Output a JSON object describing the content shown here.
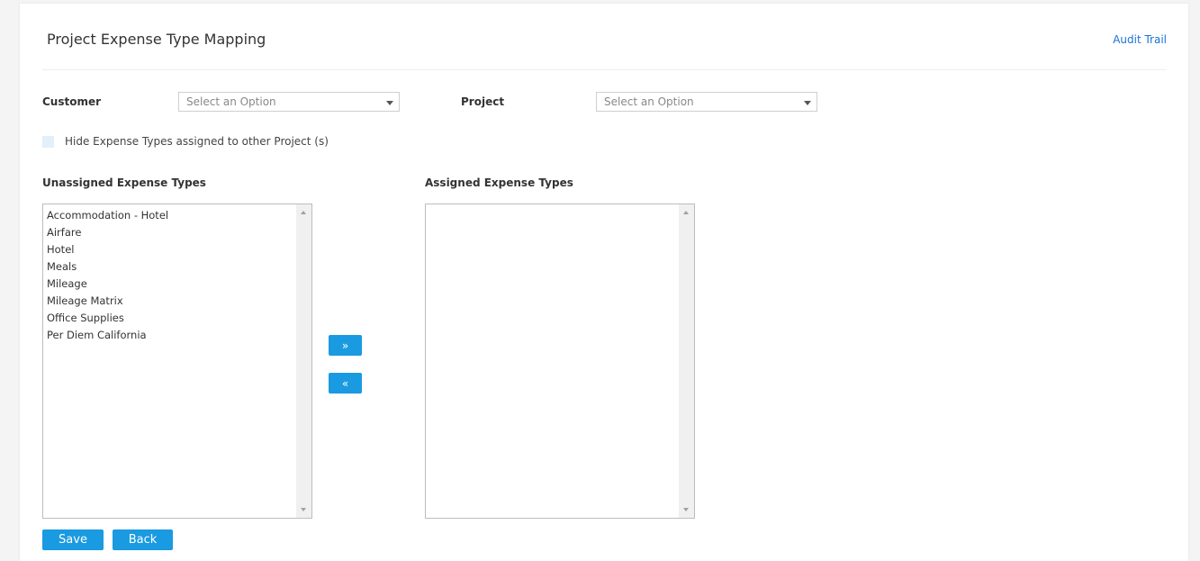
{
  "header": {
    "title": "Project Expense Type Mapping",
    "audit_trail": "Audit Trail"
  },
  "filters": {
    "customer_label": "Customer",
    "customer_placeholder": "Select an Option",
    "project_label": "Project",
    "project_placeholder": "Select an Option"
  },
  "hide_checkbox": {
    "label": "Hide Expense Types assigned to other Project (s)",
    "checked": false
  },
  "unassigned": {
    "label": "Unassigned Expense Types",
    "items": [
      "Accommodation - Hotel",
      "Airfare",
      "Hotel",
      "Meals",
      "Mileage",
      "Mileage Matrix",
      "Office Supplies",
      "Per Diem California"
    ]
  },
  "assigned": {
    "label": "Assigned Expense Types",
    "items": []
  },
  "transfer": {
    "move_right": "»",
    "move_left": "«"
  },
  "actions": {
    "save": "Save",
    "back": "Back"
  },
  "colors": {
    "accent": "#1a9ae0",
    "link": "#1a73d9"
  }
}
